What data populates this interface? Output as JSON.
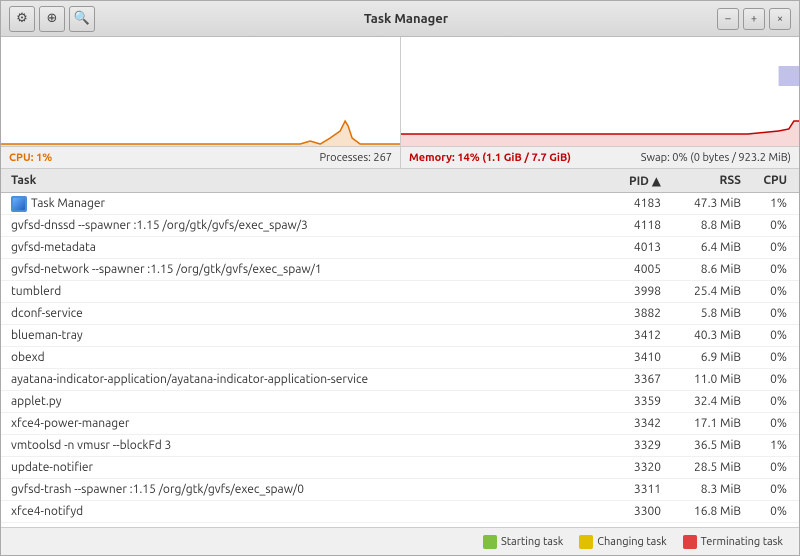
{
  "window": {
    "title": "Task Manager",
    "min_label": "–",
    "max_label": "+",
    "close_label": "×"
  },
  "toolbar": {
    "settings_icon": "⚙",
    "help_icon": "⊕",
    "search_icon": "🔍"
  },
  "status": {
    "cpu_label": "CPU: 1%",
    "processes_label": "Processes: 267",
    "memory_label": "Memory: 14% (1.1 GiB / 7.7 GiB)",
    "swap_label": "Swap: 0% (0 bytes / 923.2 MiB)"
  },
  "table": {
    "col_task": "Task",
    "col_pid": "PID ▲",
    "col_rss": "RSS",
    "col_cpu": "CPU"
  },
  "rows": [
    {
      "task": "Task Manager",
      "pid": "4183",
      "rss": "47.3 MiB",
      "cpu": "1%",
      "has_icon": true
    },
    {
      "task": "gvfsd-dnssd --spawner :1.15 /org/gtk/gvfs/exec_spaw/3",
      "pid": "4118",
      "rss": "8.8 MiB",
      "cpu": "0%",
      "has_icon": false
    },
    {
      "task": "gvfsd-metadata",
      "pid": "4013",
      "rss": "6.4 MiB",
      "cpu": "0%",
      "has_icon": false
    },
    {
      "task": "gvfsd-network --spawner :1.15 /org/gtk/gvfs/exec_spaw/1",
      "pid": "4005",
      "rss": "8.6 MiB",
      "cpu": "0%",
      "has_icon": false
    },
    {
      "task": "tumblerd",
      "pid": "3998",
      "rss": "25.4 MiB",
      "cpu": "0%",
      "has_icon": false
    },
    {
      "task": "dconf-service",
      "pid": "3882",
      "rss": "5.8 MiB",
      "cpu": "0%",
      "has_icon": false
    },
    {
      "task": "blueman-tray",
      "pid": "3412",
      "rss": "40.3 MiB",
      "cpu": "0%",
      "has_icon": false
    },
    {
      "task": "obexd",
      "pid": "3410",
      "rss": "6.9 MiB",
      "cpu": "0%",
      "has_icon": false
    },
    {
      "task": "ayatana-indicator-application/ayatana-indicator-application-service",
      "pid": "3367",
      "rss": "11.0 MiB",
      "cpu": "0%",
      "has_icon": false
    },
    {
      "task": "applet.py",
      "pid": "3359",
      "rss": "32.4 MiB",
      "cpu": "0%",
      "has_icon": false
    },
    {
      "task": "xfce4-power-manager",
      "pid": "3342",
      "rss": "17.1 MiB",
      "cpu": "0%",
      "has_icon": false
    },
    {
      "task": "vmtoolsd -n vmusr --blockFd 3",
      "pid": "3329",
      "rss": "36.5 MiB",
      "cpu": "1%",
      "has_icon": false
    },
    {
      "task": "update-notifier",
      "pid": "3320",
      "rss": "28.5 MiB",
      "cpu": "0%",
      "has_icon": false
    },
    {
      "task": "gvfsd-trash --spawner :1.15 /org/gtk/gvfs/exec_spaw/0",
      "pid": "3311",
      "rss": "8.3 MiB",
      "cpu": "0%",
      "has_icon": false
    },
    {
      "task": "xfce4-notifyd",
      "pid": "3300",
      "rss": "16.8 MiB",
      "cpu": "0%",
      "has_icon": false
    }
  ],
  "legend": {
    "starting_label": "Starting task",
    "changing_label": "Changing task",
    "terminating_label": "Terminating task",
    "starting_color": "#80c040",
    "changing_color": "#e0c000",
    "terminating_color": "#e04040"
  }
}
